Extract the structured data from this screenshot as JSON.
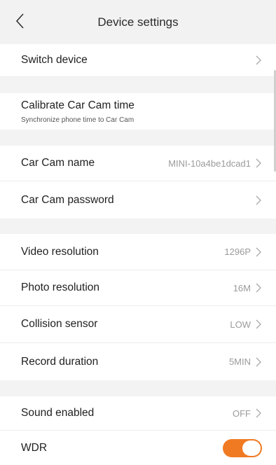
{
  "header": {
    "title": "Device settings"
  },
  "rows": {
    "switch_device": {
      "label": "Switch device"
    },
    "calibrate": {
      "label": "Calibrate Car Cam time",
      "sub": "Synchronize phone time to Car Cam"
    },
    "cam_name": {
      "label": "Car Cam name",
      "value": "MINI-10a4be1dcad1"
    },
    "cam_password": {
      "label": "Car Cam password"
    },
    "video_resolution": {
      "label": "Video resolution",
      "value": "1296P"
    },
    "photo_resolution": {
      "label": "Photo resolution",
      "value": "16M"
    },
    "collision_sensor": {
      "label": "Collision sensor",
      "value": "LOW"
    },
    "record_duration": {
      "label": "Record duration",
      "value": "5MIN"
    },
    "sound_enabled": {
      "label": "Sound enabled",
      "value": "OFF"
    },
    "wdr": {
      "label": "WDR",
      "toggle_on": true
    }
  },
  "colors": {
    "accent": "#f07a22",
    "header_bg": "#f2f2f2",
    "section_gap": "#f3f3f3"
  },
  "icons": {
    "back": "chevron-left-icon",
    "row": "chevron-right-icon"
  }
}
